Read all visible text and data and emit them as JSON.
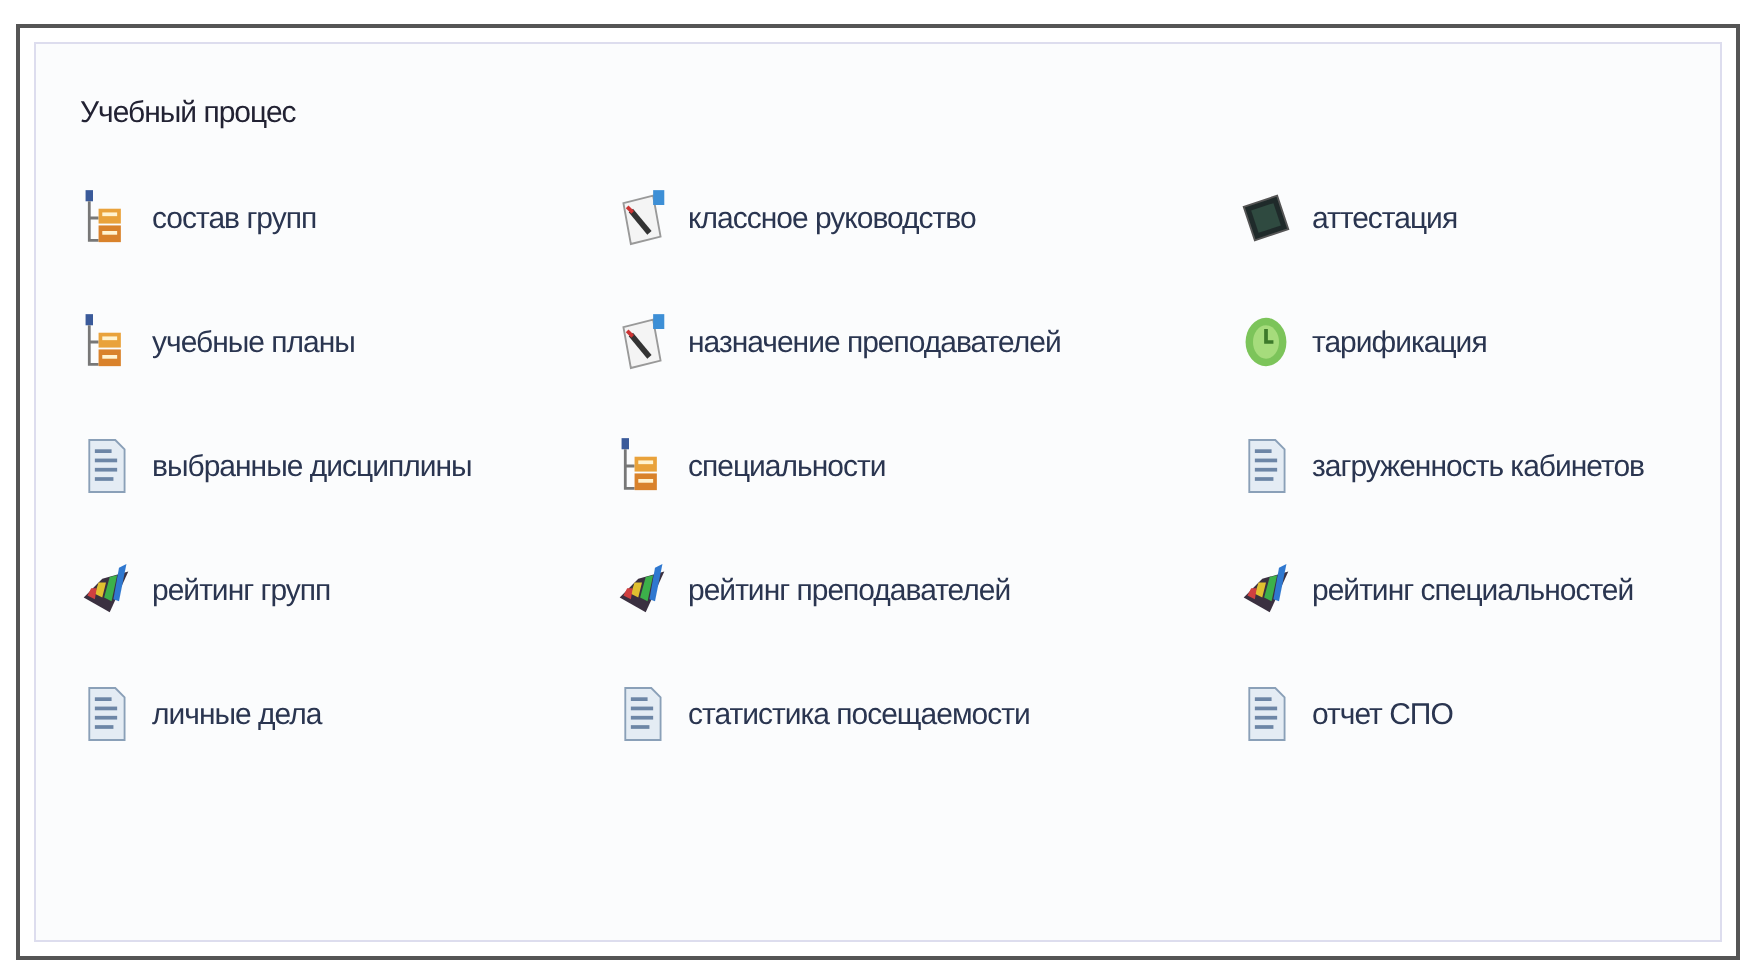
{
  "panel": {
    "title": "Учебный процес",
    "items": [
      {
        "kind": "tree",
        "label": "состав групп"
      },
      {
        "kind": "pen",
        "label": "классное руководство"
      },
      {
        "kind": "screen",
        "label": "аттестация"
      },
      {
        "kind": "tree",
        "label": "учебные планы"
      },
      {
        "kind": "pen",
        "label": "назначение преподавателей"
      },
      {
        "kind": "clock",
        "label": "тарификация"
      },
      {
        "kind": "doc",
        "label": "выбранные дисциплины"
      },
      {
        "kind": "tree",
        "label": "специальности"
      },
      {
        "kind": "doc",
        "label": "загруженность кабинетов"
      },
      {
        "kind": "chart",
        "label": "рейтинг групп"
      },
      {
        "kind": "chart",
        "label": "рейтинг преподавателей"
      },
      {
        "kind": "chart",
        "label": "рейтинг специальностей"
      },
      {
        "kind": "doc",
        "label": "личные дела"
      },
      {
        "kind": "doc",
        "label": "статистика посещаемости"
      },
      {
        "kind": "doc",
        "label": "отчет СПО"
      }
    ]
  }
}
